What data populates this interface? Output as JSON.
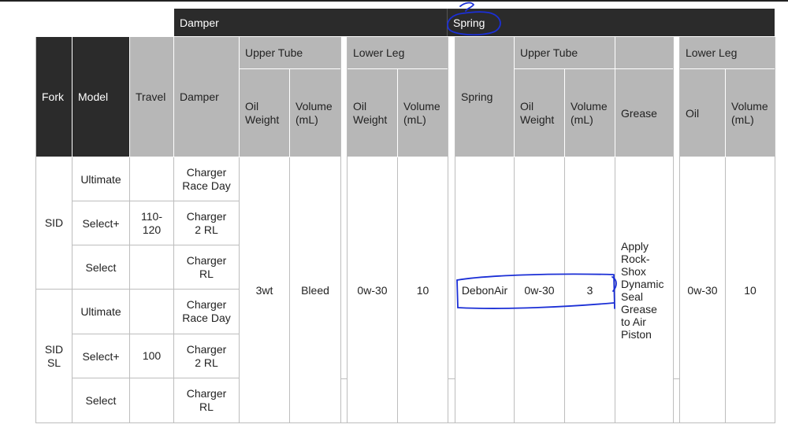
{
  "group_headers": {
    "damper": "Damper",
    "spring": "Spring"
  },
  "headers": {
    "fork": "Fork",
    "model": "Model",
    "travel": "Travel",
    "damper": "Damper",
    "upper_tube": "Upper Tube",
    "lower_leg": "Lower Leg",
    "spring": "Spring",
    "upper_tube_2": "Upper Tube",
    "lower_leg_2": "Lower Leg",
    "oil_weight_1": "Oil\nWeight",
    "volume_1": "Volume\n(mL)",
    "oil_weight_2": "Oil\nWeight",
    "volume_2": "Volume\n(mL)",
    "oil_weight_3": "Oil\nWeight",
    "volume_3": "Volume\n(mL)",
    "grease": "Grease",
    "oil": "Oil",
    "volume_4": "Volume\n(mL)"
  },
  "rows": {
    "fork_sid": "SID",
    "fork_sid_sl": "SID\nSL",
    "models": [
      "Ultimate",
      "Select+",
      "Select",
      "Ultimate",
      "Select+",
      "Select"
    ],
    "travel_sid": "110-\n120",
    "travel_sid_sl": "100",
    "dampers": [
      "Charger\nRace Day",
      "Charger\n2 RL",
      "Charger\nRL",
      "Charger\nRace Day",
      "Charger\n2 RL",
      "Charger\nRL"
    ],
    "upper_oil_weight": "3wt",
    "upper_volume": "Bleed",
    "lower_oil_weight": "0w-30",
    "lower_volume": "10",
    "spring": "DebonAir",
    "spring_upper_oil_weight": "0w-30",
    "spring_upper_volume": "3",
    "grease": "Apply\nRock-\nShox\nDynamic\nSeal\nGrease\nto Air\nPiston",
    "spring_lower_oil": "0w-30",
    "spring_lower_volume": "10"
  },
  "annotation_color": "#1b2fd6"
}
